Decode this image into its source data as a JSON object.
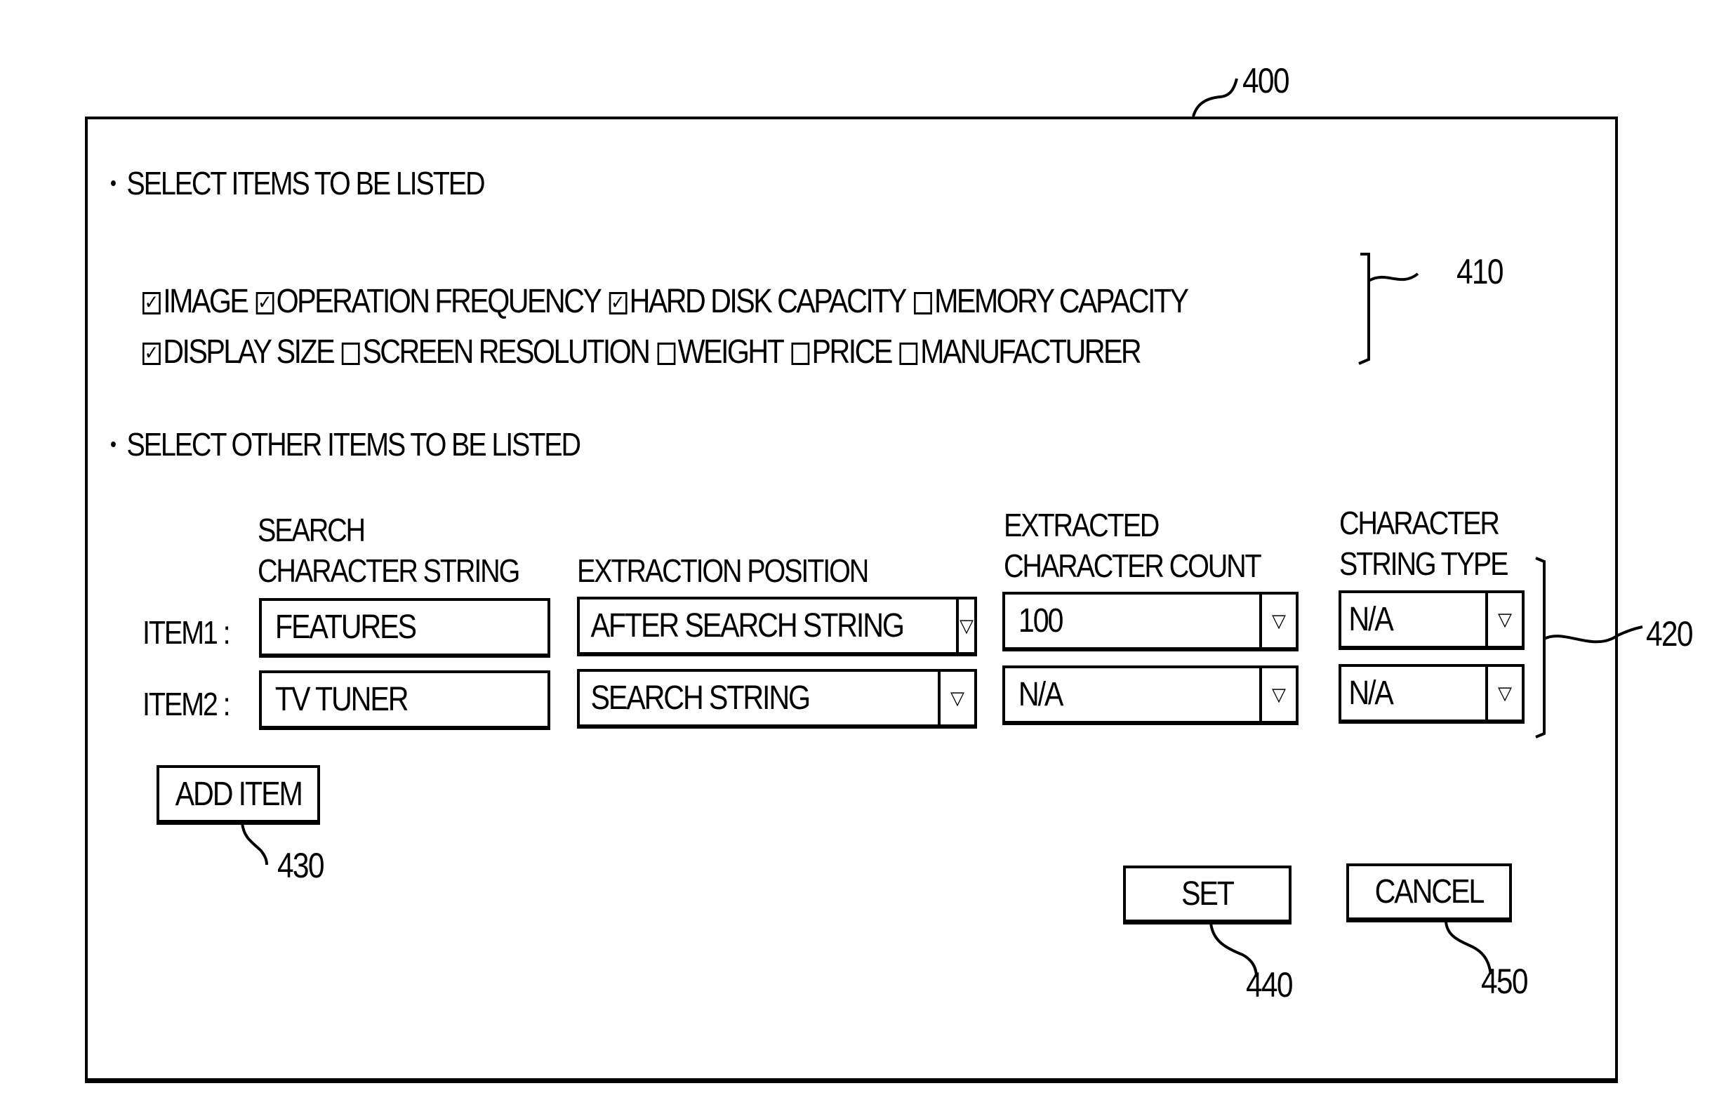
{
  "reference_labels": {
    "dialog": "400",
    "checkbox_group": "410",
    "other_items_group": "420",
    "add_item": "430",
    "set": "440",
    "cancel": "450"
  },
  "section1": {
    "heading": "SELECT ITEMS TO BE LISTED",
    "checkbox_rows": [
      [
        {
          "label": "IMAGE",
          "checked": true
        },
        {
          "label": "OPERATION FREQUENCY",
          "checked": true
        },
        {
          "label": "HARD DISK CAPACITY",
          "checked": true
        },
        {
          "label": "MEMORY CAPACITY",
          "checked": false
        }
      ],
      [
        {
          "label": "DISPLAY SIZE",
          "checked": true
        },
        {
          "label": "SCREEN RESOLUTION",
          "checked": false
        },
        {
          "label": "WEIGHT",
          "checked": false
        },
        {
          "label": "PRICE",
          "checked": false
        },
        {
          "label": "MANUFACTURER",
          "checked": false
        }
      ]
    ]
  },
  "section2": {
    "heading": "SELECT OTHER ITEMS TO BE LISTED",
    "columns": {
      "search_string": [
        "SEARCH",
        "CHARACTER STRING"
      ],
      "extraction_position": [
        "EXTRACTION POSITION"
      ],
      "char_count": [
        "EXTRACTED",
        "CHARACTER COUNT"
      ],
      "string_type": [
        "CHARACTER",
        "STRING TYPE"
      ]
    },
    "rows": [
      {
        "label": "ITEM1 :",
        "search_string": "FEATURES",
        "extraction_position": "AFTER SEARCH STRING",
        "char_count": "100",
        "string_type": "N/A"
      },
      {
        "label": "ITEM2 :",
        "search_string": "TV TUNER",
        "extraction_position": "SEARCH STRING",
        "char_count": "N/A",
        "string_type": "N/A"
      }
    ],
    "dropdown_icon": "triangle-down-icon"
  },
  "buttons": {
    "add_item": "ADD ITEM",
    "set": "SET",
    "cancel": "CANCEL"
  }
}
